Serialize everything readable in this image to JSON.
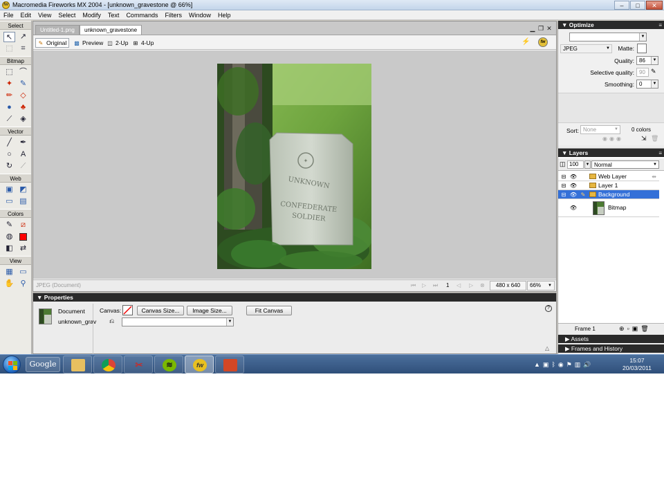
{
  "window": {
    "title": "Macromedia Fireworks MX 2004 - [unknown_gravestone @ 66%]",
    "minimize": "–",
    "maximize": "□",
    "close": "✕"
  },
  "menu": [
    "File",
    "Edit",
    "View",
    "Select",
    "Modify",
    "Text",
    "Commands",
    "Filters",
    "Window",
    "Help"
  ],
  "toolbox": {
    "sections": [
      "Select",
      "Bitmap",
      "Vector",
      "Web",
      "Colors",
      "View"
    ]
  },
  "document": {
    "tabs": [
      "Untitled-1.png",
      "unknown_gravestone"
    ],
    "view_buttons": [
      "Original",
      "Preview",
      "2-Up",
      "4-Up"
    ],
    "status_format": "JPEG (Document)",
    "frame": "1",
    "size": "480 x 640",
    "zoom": "66%",
    "image_text": [
      "UNKNOWN",
      "CONFEDERATE",
      "SOLDIER"
    ]
  },
  "properties": {
    "title": "Properties",
    "type_label": "Document",
    "file_name": "unknown_grav",
    "canvas_label": "Canvas:",
    "canvas_size_button": "Canvas Size...",
    "image_size_button": "Image Size...",
    "fit_canvas_button": "Fit Canvas",
    "help": "?"
  },
  "optimize": {
    "title": "Optimize",
    "settings_value": "",
    "format": "JPEG",
    "matte_label": "Matte:",
    "quality_label": "Quality:",
    "quality_value": "86",
    "selective_quality_label": "Selective quality:",
    "selective_quality_value": "90",
    "smoothing_label": "Smoothing:",
    "smoothing_value": "0",
    "sort_label": "Sort:",
    "sort_value": "None",
    "colors_count": "0 colors"
  },
  "layers": {
    "title": "Layers",
    "opacity": "100",
    "blend_mode": "Normal",
    "rows": [
      {
        "name": "Web Layer"
      },
      {
        "name": "Layer 1"
      },
      {
        "name": "Background"
      },
      {
        "name": "Bitmap"
      }
    ],
    "frame_label": "Frame 1"
  },
  "collapsed_panels": [
    "Assets",
    "Frames and History"
  ],
  "taskbar": {
    "google": "Google",
    "fireworks_icon": "fw",
    "time": "15:07",
    "date": "20/03/2011"
  }
}
